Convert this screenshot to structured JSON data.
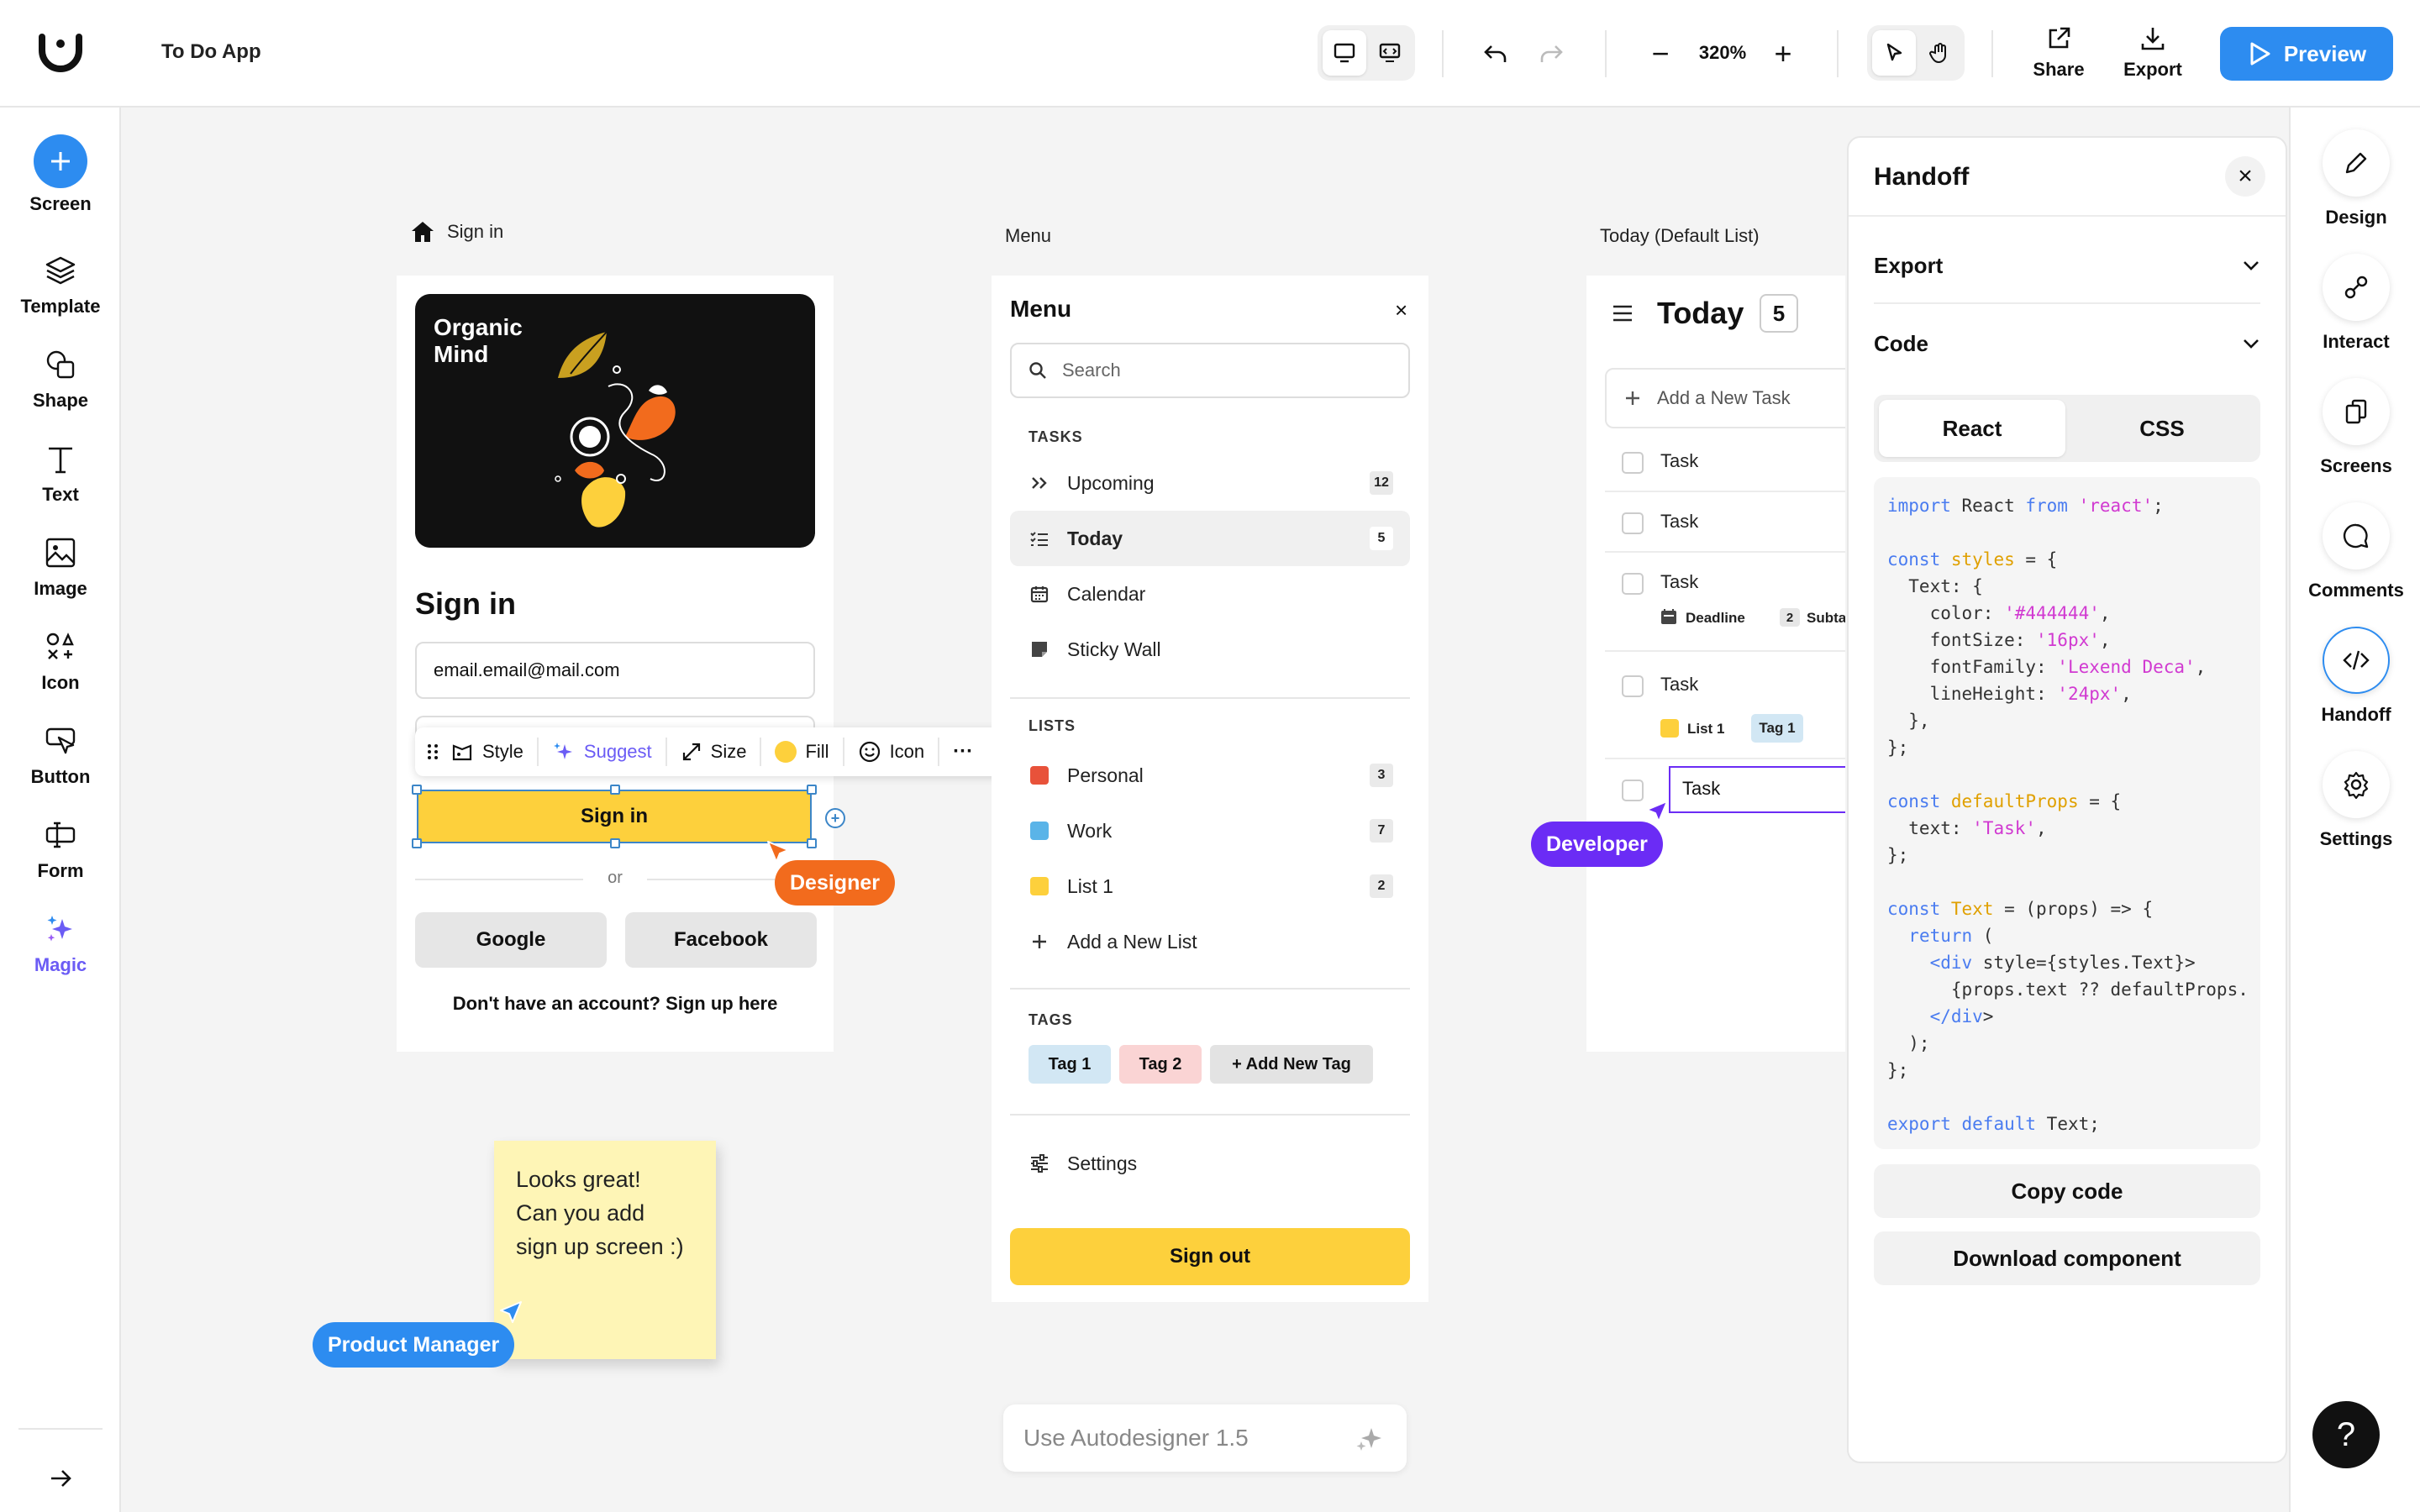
{
  "app": {
    "title": "To Do App"
  },
  "toolbar": {
    "zoom": "320%",
    "share_label": "Share",
    "export_label": "Export",
    "preview_label": "Preview"
  },
  "leftbar": {
    "items": [
      {
        "label": "Screen"
      },
      {
        "label": "Template"
      },
      {
        "label": "Shape"
      },
      {
        "label": "Text"
      },
      {
        "label": "Image"
      },
      {
        "label": "Icon"
      },
      {
        "label": "Button"
      },
      {
        "label": "Form"
      },
      {
        "label": "Magic"
      }
    ]
  },
  "rightbar": {
    "items": [
      {
        "label": "Design"
      },
      {
        "label": "Interact"
      },
      {
        "label": "Screens"
      },
      {
        "label": "Comments"
      },
      {
        "label": "Handoff"
      },
      {
        "label": "Settings"
      }
    ],
    "help": "?"
  },
  "handoff": {
    "title": "Handoff",
    "sections": {
      "export": "Export",
      "code": "Code"
    },
    "tabs": [
      "React",
      "CSS"
    ],
    "code_lines": [
      "import React from 'react';",
      "",
      "const styles = {",
      "  Text: {",
      "    color: '#444444',",
      "    fontSize: '16px',",
      "    fontFamily: 'Lexend Deca',",
      "    lineHeight: '24px',",
      "  },",
      "};",
      "",
      "const defaultProps = {",
      "  text: 'Task',",
      "};",
      "",
      "const Text = (props) => {",
      "  return (",
      "    <div style={styles.Text}>",
      "      {props.text ?? defaultProps.",
      "    </div>",
      "  );",
      "};",
      "",
      "export default Text;"
    ],
    "copy_label": "Copy code",
    "download_label": "Download component"
  },
  "signin_frame": {
    "label": "Sign in",
    "banner_title": "Organic\nMind",
    "title": "Sign in",
    "email_value": "email.email@mail.com",
    "button": "Sign in",
    "or": "or",
    "google": "Google",
    "facebook": "Facebook",
    "footer": "Don't have an account? Sign up here"
  },
  "floating_toolbar": {
    "style": "Style",
    "suggest": "Suggest",
    "size": "Size",
    "fill": "Fill",
    "icon": "Icon",
    "more": "···"
  },
  "menu_frame": {
    "label": "Menu",
    "title": "Menu",
    "close": "×",
    "search_placeholder": "Search",
    "tasks_header": "TASKS",
    "tasks": [
      {
        "label": "Upcoming",
        "count": "12"
      },
      {
        "label": "Today",
        "count": "5"
      },
      {
        "label": "Calendar"
      },
      {
        "label": "Sticky Wall"
      }
    ],
    "lists_header": "LISTS",
    "lists": [
      {
        "label": "Personal",
        "count": "3",
        "color": "#e8523a"
      },
      {
        "label": "Work",
        "count": "7",
        "color": "#5ab4e8"
      },
      {
        "label": "List 1",
        "count": "2",
        "color": "#fdd03c"
      }
    ],
    "add_list": "Add a New List",
    "tags_header": "TAGS",
    "tags": [
      {
        "label": "Tag 1",
        "bg": "#d2e7f4"
      },
      {
        "label": "Tag 2",
        "bg": "#fad4d4"
      },
      {
        "label": "+ Add New Tag",
        "bg": "#e3e3e3"
      }
    ],
    "settings": "Settings",
    "signout": "Sign out"
  },
  "today_frame": {
    "label": "Today (Default List)",
    "title": "Today",
    "count": "5",
    "add_task": "Add a New Task",
    "task": "Task",
    "deadline": "Deadline",
    "subtask_count": "2",
    "subtask_label": "Subta",
    "list_label": "List 1",
    "tag_label": "Tag 1"
  },
  "collaborators": {
    "designer": "Designer",
    "developer": "Developer",
    "pm": "Product Manager"
  },
  "note": {
    "text": "Looks great!\nCan you add\nsign up screen :)"
  },
  "autodesigner": {
    "placeholder": "Use Autodesigner 1.5"
  },
  "colors": {
    "accent": "#2d8cf0",
    "yellow": "#fdd03c",
    "designer": "#f26b1d",
    "developer": "#6b2cf5",
    "pm": "#2d8cf0"
  }
}
